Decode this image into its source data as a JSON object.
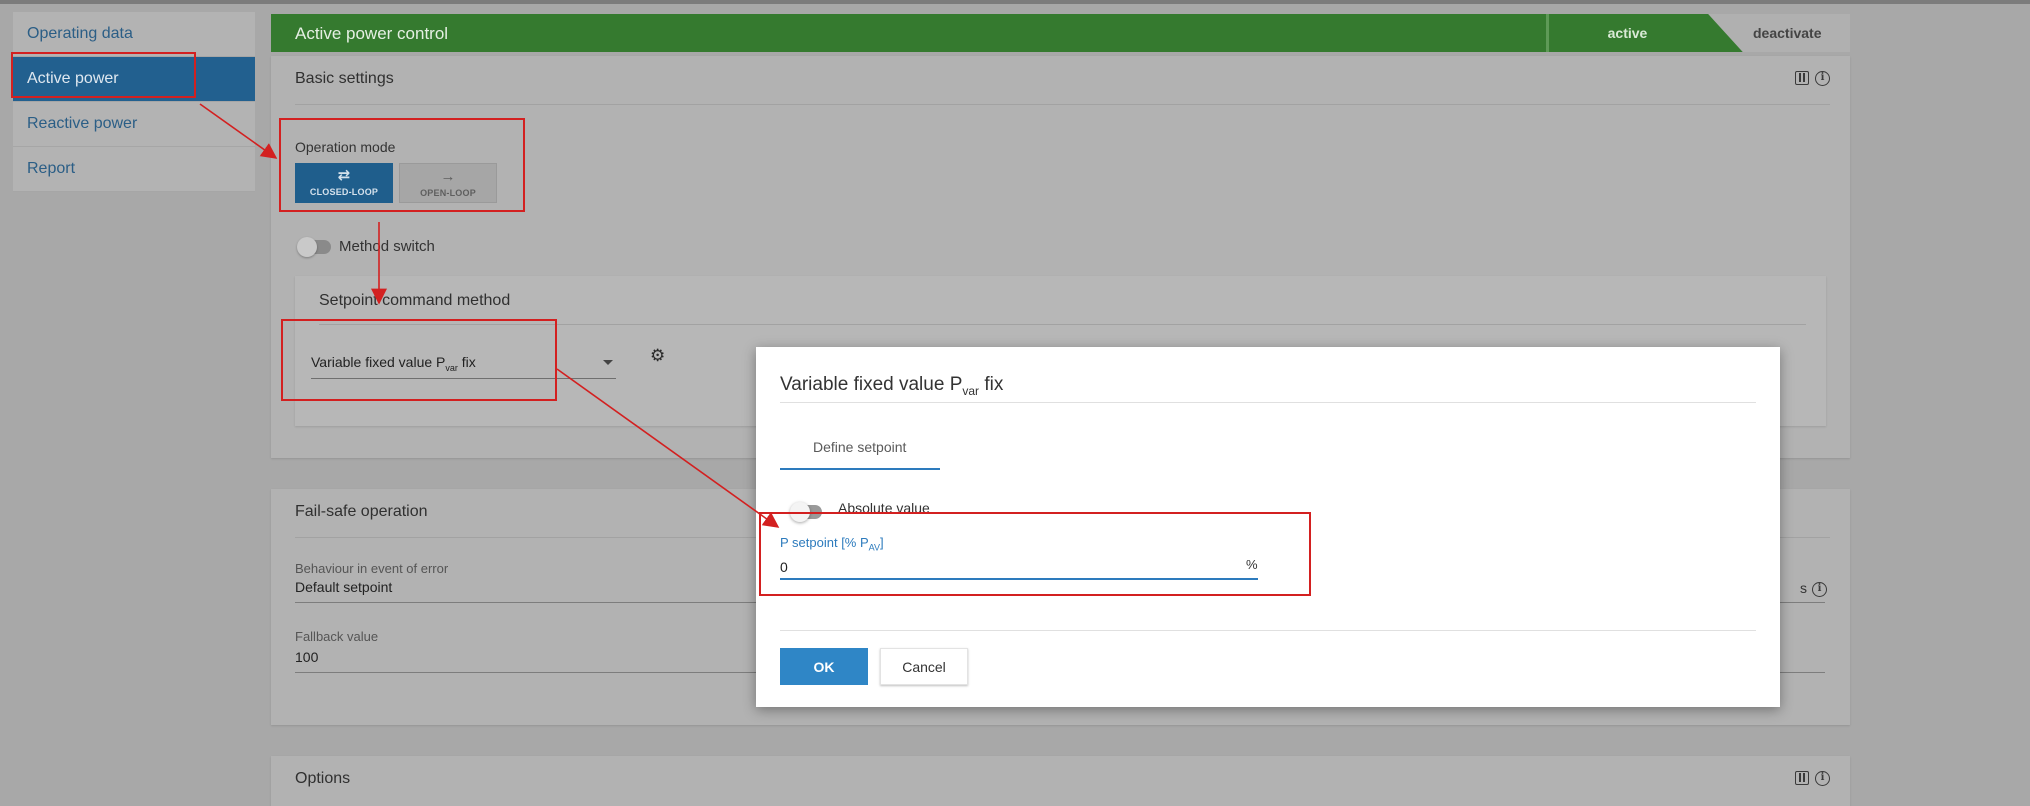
{
  "sidebar": {
    "items": [
      {
        "label": "Operating data",
        "active": false
      },
      {
        "label": "Active power",
        "active": true
      },
      {
        "label": "Reactive power",
        "active": false
      },
      {
        "label": "Report",
        "active": false
      }
    ]
  },
  "header": {
    "title": "Active power control",
    "active_label": "active",
    "deactivate_label": "deactivate",
    "accent_color": "#357a2f"
  },
  "basic_settings": {
    "title": "Basic settings",
    "operation_mode_label": "Operation mode",
    "modes": [
      {
        "label": "CLOSED-LOOP",
        "icon": "swap-arrows-icon",
        "selected": true
      },
      {
        "label": "OPEN-LOOP",
        "icon": "arrow-right-icon",
        "selected": false
      }
    ],
    "method_switch_label": "Method switch",
    "setpoint_card": {
      "title": "Setpoint command method",
      "select_main": "Variable fixed value P",
      "select_sub": "var",
      "select_suffix": " fix"
    }
  },
  "fail_safe": {
    "title": "Fail-safe operation",
    "behaviour_label": "Behaviour in event of error",
    "behaviour_value": "Default setpoint",
    "fallback_label": "Fallback value",
    "fallback_value": "100",
    "unit": "s"
  },
  "options": {
    "title": "Options"
  },
  "dialog": {
    "title_main": "Variable fixed value P",
    "title_sub": "var",
    "title_suffix": " fix",
    "tab_label": "Define setpoint",
    "absolute_value_label": "Absolute value",
    "field_label_main": "P setpoint [% P",
    "field_label_sub": "AV",
    "field_label_suffix": "]",
    "field_value": "0",
    "field_unit": "%",
    "ok_label": "OK",
    "cancel_label": "Cancel",
    "ok_color": "#2f86c6"
  },
  "annotation_color": "#d32020"
}
